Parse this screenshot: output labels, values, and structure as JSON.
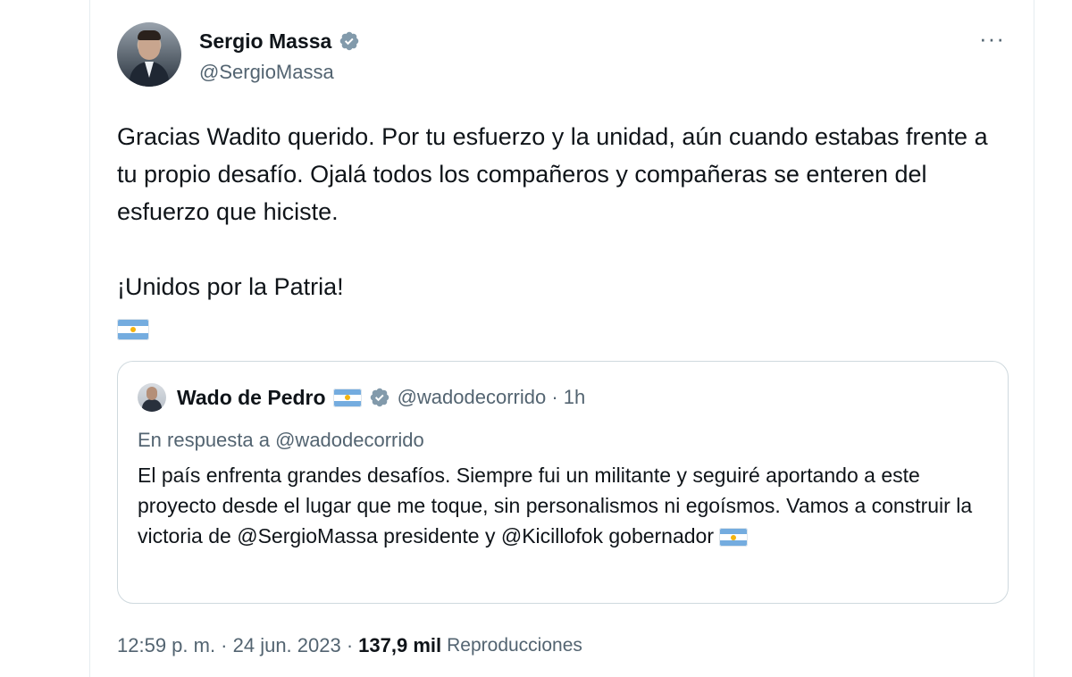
{
  "tweet": {
    "author": {
      "name": "Sergio Massa",
      "handle": "@SergioMassa"
    },
    "more_label": "···",
    "text_lines": {
      "p1": "Gracias Wadito querido. Por tu esfuerzo y la unidad, aún cuando estabas frente a tu propio desafío. Ojalá todos los compañeros y compañeras se enteren del esfuerzo que hiciste.",
      "p2": "¡Unidos por la Patria!"
    },
    "emoji": "argentina-flag"
  },
  "quoted": {
    "author": {
      "name": "Wado de Pedro",
      "handle_time": "@wadodecorrido · 1h"
    },
    "reply_to": "En respuesta a @wadodecorrido",
    "text": "El país enfrenta grandes desafíos. Siempre fui un militante y seguiré aportando a este proyecto desde el lugar que me toque, sin personalismos ni egoísmos. Vamos a construir la victoria de @SergioMassa presidente y @Kicillofok gobernador"
  },
  "meta": {
    "time_date": "12:59 p. m. · 24 jun. 2023 ·",
    "views_count": "137,9 mil",
    "views_label": "Reproducciones"
  },
  "colors": {
    "text": "#0f1419",
    "secondary": "#536471",
    "verified_badge": "#829aab",
    "border": "#cfd9de",
    "flag_blue": "#74acdf",
    "flag_sun": "#f6b40e"
  }
}
